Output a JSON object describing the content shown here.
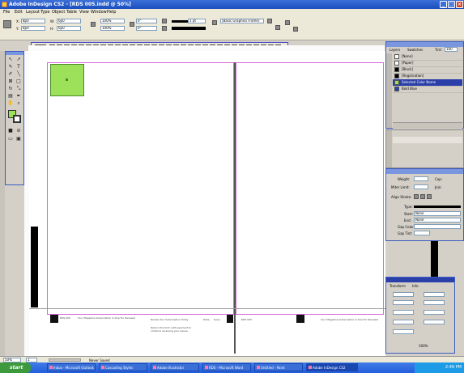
{
  "window": {
    "title": "Adobe InDesign CS2 - [RDS 005.indd @ 50%]",
    "controls": {
      "minimize": "_",
      "maximize": "□",
      "close": "×"
    }
  },
  "menu": [
    "File",
    "Edit",
    "Layout",
    "Type",
    "Object",
    "Table",
    "View",
    "Window",
    "Help"
  ],
  "control_bar": {
    "x_label": "X:",
    "y_label": "Y:",
    "w_label": "W:",
    "h_label": "H:",
    "x_value": "8p0",
    "y_value": "8p0",
    "w_value": "6p0",
    "h_value": "6p0",
    "scale_x": "100%",
    "scale_y": "100%",
    "rotation": "0°",
    "shear": "0°",
    "stroke_weight": "1 pt",
    "style_value": "[Basic Graphics Frame]",
    "zoom": "50%"
  },
  "layers_panel": {
    "tabs": [
      "Layers",
      "Swatches"
    ],
    "tint_label": "Tint:",
    "tint_value": "100",
    "items": [
      {
        "name": "[None]",
        "color": "#ffffff"
      },
      {
        "name": "[Paper]",
        "color": "#ffffff"
      },
      {
        "name": "[Black]",
        "color": "#000000"
      },
      {
        "name": "[Registration]",
        "color": "#000000"
      },
      {
        "name": "Selected Color Name",
        "color": "#9de05a"
      },
      {
        "name": "Bold Blue",
        "color": "#2244aa"
      }
    ],
    "selected_index": 4
  },
  "stroke_panel": {
    "weight_label": "Weight:",
    "cap_label": "Cap:",
    "miter_label": "Miter Limit:",
    "join_label": "Join:",
    "align_label": "Align Stroke:",
    "type_label": "Type:",
    "start_label": "Start:",
    "end_label": "End:",
    "start_value": "None",
    "end_value": "None",
    "gap_color_label": "Gap Color:",
    "gap_tint_label": "Gap Tint:"
  },
  "float_panel": {
    "tabs": [
      "Transform",
      "Info"
    ],
    "zoom_label": "100%"
  },
  "status_bar": {
    "zoom": "50%",
    "page": "1",
    "status": "Never Saved"
  },
  "taskbar": {
    "start": "start",
    "tasks": [
      "Inbox - Microsoft Outlook",
      "Cascading Styles",
      "Adobe Illustrator",
      "RDS - Microsoft Word",
      "Untitled - Paint",
      "Adobe InDesign CS2"
    ],
    "clock": "2:49 PM"
  },
  "slug": {
    "left_heading": "RDS 005",
    "left_text": "Your Magazine Subscription Is Due For Renewal",
    "mid_heading": "Renew Your Subscription Today",
    "mid_text": "Return this form with payment to continue receiving your issues.",
    "date_label": "Date:",
    "issue_label": "Issue",
    "right_heading": "RDS 005",
    "right_text": "Your Magazine Subscription Is Due For Renewal"
  }
}
